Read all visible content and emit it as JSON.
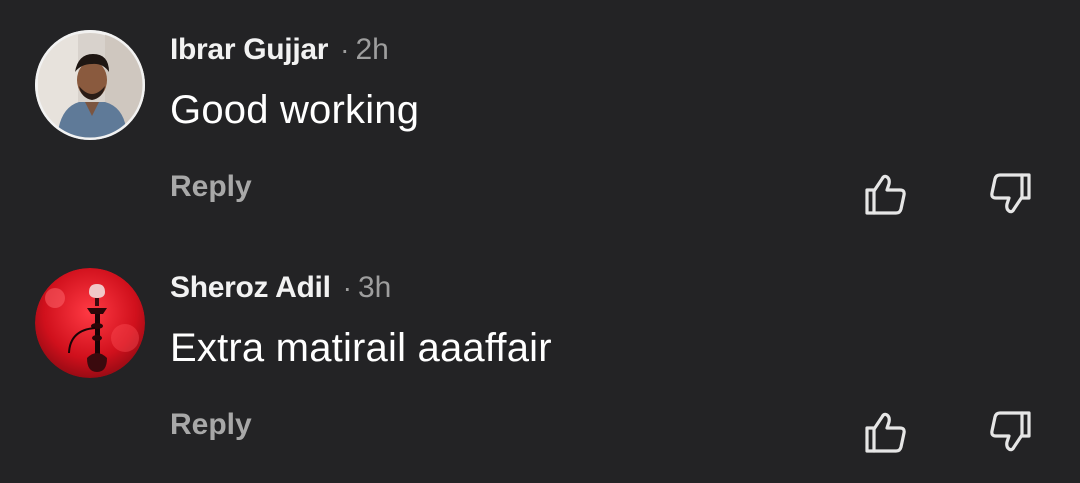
{
  "comments": [
    {
      "author": "Ibrar Gujjar",
      "separator": "·",
      "time": "2h",
      "text": "Good working",
      "reply_label": "Reply",
      "avatar": "profile-photo-man"
    },
    {
      "author": "Sheroz Adil",
      "separator": "·",
      "time": "3h",
      "text": "Extra matirail aaaffair",
      "reply_label": "Reply",
      "avatar": "profile-photo-red-hookah"
    }
  ],
  "icons": {
    "like": "thumbs-up-outline-icon",
    "dislike": "thumbs-down-outline-icon"
  },
  "colors": {
    "background": "#232325",
    "primary_text": "#ffffff",
    "secondary_text": "#9e9e9e",
    "icon": "#e6e6e6"
  }
}
